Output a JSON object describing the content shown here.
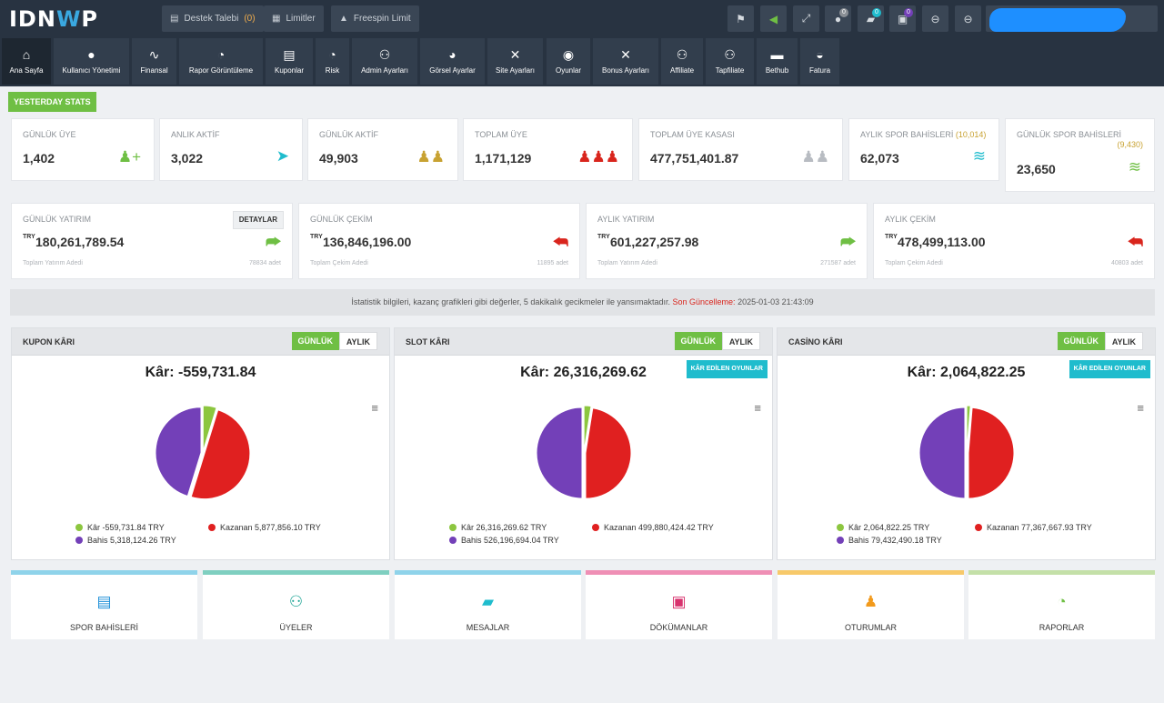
{
  "brand": {
    "logo": "IDNWP"
  },
  "topbar": {
    "support_label": "Destek Talebi",
    "support_count": "(0)",
    "limits_label": "Limitler",
    "freespin_label": "Freespin Limit",
    "icons": [
      "flag-icon",
      "volume-icon",
      "expand-icon",
      "user-icon",
      "chat-icon",
      "image-icon",
      "minus-circle-icon",
      "minus-circle-icon-2"
    ],
    "badges": {
      "user": "0",
      "chat": "0",
      "image": "0"
    }
  },
  "nav": [
    {
      "label": "Ana Sayfa",
      "icon": "home-icon"
    },
    {
      "label": "Kullanıcı Yönetimi",
      "icon": "user-icon"
    },
    {
      "label": "Finansal",
      "icon": "pulse-icon"
    },
    {
      "label": "Rapor Görüntüleme",
      "icon": "gauge-icon"
    },
    {
      "label": "Kuponlar",
      "icon": "book-icon"
    },
    {
      "label": "Risk",
      "icon": "gauge-icon"
    },
    {
      "label": "Admin Ayarları",
      "icon": "users-icon"
    },
    {
      "label": "Görsel Ayarlar",
      "icon": "palette-icon"
    },
    {
      "label": "Site Ayarları",
      "icon": "tools-icon"
    },
    {
      "label": "Oyunlar",
      "icon": "ball-icon"
    },
    {
      "label": "Bonus Ayarları",
      "icon": "tools-icon"
    },
    {
      "label": "Affiliate",
      "icon": "users-icon"
    },
    {
      "label": "Tapfiliate",
      "icon": "users-icon"
    },
    {
      "label": "Bethub",
      "icon": "folder-icon"
    },
    {
      "label": "Fatura",
      "icon": "pie-icon"
    }
  ],
  "yesterday_label": "YESTERDAY STATS",
  "stats": [
    {
      "label": "GÜNLÜK ÜYE",
      "value": "1,402",
      "icon": "user-add-icon",
      "color": "#6fbf44"
    },
    {
      "label": "ANLIK AKTİF",
      "value": "3,022",
      "icon": "location-icon",
      "color": "#1fbccd"
    },
    {
      "label": "GÜNLÜK AKTİF",
      "value": "49,903",
      "icon": "users-icon",
      "color": "#c8a232"
    },
    {
      "label": "TOPLAM ÜYE",
      "value": "1,171,129",
      "icon": "group-icon",
      "color": "#d9251d"
    },
    {
      "label": "TOPLAM ÜYE KASASI",
      "value": "477,751,401.87",
      "icon": "users-icon",
      "color": "#b8bcc2"
    },
    {
      "label": "AYLIK SPOR BAHİSLERİ",
      "sub": "(10,014)",
      "value": "62,073",
      "icon": "layers-icon",
      "color": "#1fbccd"
    },
    {
      "label": "GÜNLÜK SPOR BAHİSLERİ",
      "sub": "(9,430)",
      "value": "23,650",
      "icon": "layers-icon",
      "color": "#6fbf44"
    }
  ],
  "finance": [
    {
      "label": "GÜNLÜK YATIRIM",
      "currency": "TRY",
      "amount": "180,261,789.54",
      "footer": "Toplam Yatırım Adedi",
      "count": "78834 adet",
      "detail": "DETAYLAR",
      "icon": "share-icon",
      "color": "#6fbf44"
    },
    {
      "label": "GÜNLÜK ÇEKİM",
      "currency": "TRY",
      "amount": "136,846,196.00",
      "footer": "Toplam Çekim Adedi",
      "count": "11895 adet",
      "icon": "reply-icon",
      "color": "#d9251d"
    },
    {
      "label": "AYLIK YATIRIM",
      "currency": "TRY",
      "amount": "601,227,257.98",
      "footer": "Toplam Yatırım Adedi",
      "count": "271587 adet",
      "icon": "share-icon",
      "color": "#6fbf44"
    },
    {
      "label": "AYLIK ÇEKİM",
      "currency": "TRY",
      "amount": "478,499,113.00",
      "footer": "Toplam Çekim Adedi",
      "count": "40803 adet",
      "icon": "reply-icon",
      "color": "#d9251d"
    }
  ],
  "notice": {
    "text": "İstatistik bilgileri, kazanç grafikleri gibi değerler, 5 dakikalık gecikmeler ile yansımaktadır.",
    "updated_label": "Son Güncelleme:",
    "updated_value": "2025-01-03 21:43:09"
  },
  "panels": [
    {
      "title": "KUPON KÂRI",
      "daily": "GÜNLÜK",
      "monthly": "AYLIK",
      "kar": "Kâr: -559,731.84",
      "button": null
    },
    {
      "title": "SLOT KÂRI",
      "daily": "GÜNLÜK",
      "monthly": "AYLIK",
      "kar": "Kâr: 26,316,269.62",
      "button": "KÂR EDİLEN OYUNLAR"
    },
    {
      "title": "CASİNO KÂRI",
      "daily": "GÜNLÜK",
      "monthly": "AYLIK",
      "kar": "Kâr: 2,064,822.25",
      "button": "KÂR EDİLEN OYUNLAR"
    }
  ],
  "chart_data": [
    {
      "type": "pie",
      "title": "KUPON KÂRI",
      "colors": [
        "#8cc63f",
        "#e02020",
        "#7340b8"
      ],
      "labels": [
        "Kâr",
        "Kazanan",
        "Bahis"
      ],
      "values": [
        -559731.84,
        5877856.1,
        5318124.26
      ],
      "legend": [
        "Kâr -559,731.84 TRY",
        "Kazanan 5,877,856.10 TRY",
        "Bahis 5,318,124.26 TRY"
      ]
    },
    {
      "type": "pie",
      "title": "SLOT KÂRI",
      "colors": [
        "#8cc63f",
        "#e02020",
        "#7340b8"
      ],
      "labels": [
        "Kâr",
        "Kazanan",
        "Bahis"
      ],
      "values": [
        26316269.62,
        499880424.42,
        526196694.04
      ],
      "legend": [
        "Kâr 26,316,269.62 TRY",
        "Kazanan 499,880,424.42 TRY",
        "Bahis 526,196,694.04 TRY"
      ]
    },
    {
      "type": "pie",
      "title": "CASİNO KÂRI",
      "colors": [
        "#8cc63f",
        "#e02020",
        "#7340b8"
      ],
      "labels": [
        "Kâr",
        "Kazanan",
        "Bahis"
      ],
      "values": [
        2064822.25,
        77367667.93,
        79432490.18
      ],
      "legend": [
        "Kâr 2,064,822.25 TRY",
        "Kazanan 77,367,667.93 TRY",
        "Bahis 79,432,490.18 TRY"
      ]
    }
  ],
  "tiles": [
    {
      "label": "SPOR BAHİSLERİ",
      "icon": "book-icon",
      "color": "#8fd3ea",
      "icon_color": "#1e90d8"
    },
    {
      "label": "ÜYELER",
      "icon": "users-icon",
      "color": "#7fcfc0",
      "icon_color": "#1aa394"
    },
    {
      "label": "MESAJLAR",
      "icon": "chat-icon",
      "color": "#8fd3ea",
      "icon_color": "#1fbccd"
    },
    {
      "label": "DÖKÜMANLAR",
      "icon": "images-icon",
      "color": "#ef8fb5",
      "icon_color": "#d8336e"
    },
    {
      "label": "OTURUMLAR",
      "icon": "person-icon",
      "color": "#f7c96a",
      "icon_color": "#f29a1c"
    },
    {
      "label": "RAPORLAR",
      "icon": "gauge-icon",
      "color": "#c4e0a8",
      "icon_color": "#6fbf44"
    }
  ]
}
